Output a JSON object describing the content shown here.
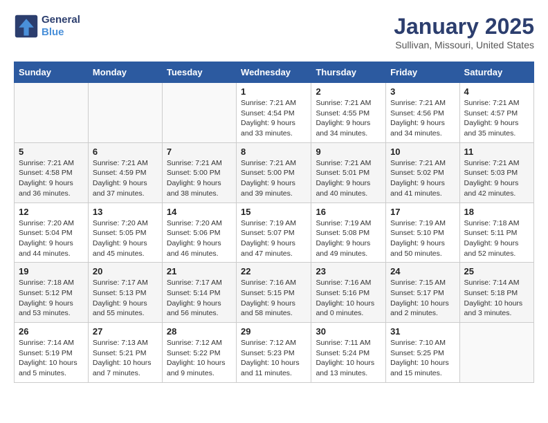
{
  "logo": {
    "line1": "General",
    "line2": "Blue"
  },
  "title": "January 2025",
  "subtitle": "Sullivan, Missouri, United States",
  "days_of_week": [
    "Sunday",
    "Monday",
    "Tuesday",
    "Wednesday",
    "Thursday",
    "Friday",
    "Saturday"
  ],
  "weeks": [
    [
      {
        "day": "",
        "text": ""
      },
      {
        "day": "",
        "text": ""
      },
      {
        "day": "",
        "text": ""
      },
      {
        "day": "1",
        "text": "Sunrise: 7:21 AM\nSunset: 4:54 PM\nDaylight: 9 hours and 33 minutes."
      },
      {
        "day": "2",
        "text": "Sunrise: 7:21 AM\nSunset: 4:55 PM\nDaylight: 9 hours and 34 minutes."
      },
      {
        "day": "3",
        "text": "Sunrise: 7:21 AM\nSunset: 4:56 PM\nDaylight: 9 hours and 34 minutes."
      },
      {
        "day": "4",
        "text": "Sunrise: 7:21 AM\nSunset: 4:57 PM\nDaylight: 9 hours and 35 minutes."
      }
    ],
    [
      {
        "day": "5",
        "text": "Sunrise: 7:21 AM\nSunset: 4:58 PM\nDaylight: 9 hours and 36 minutes."
      },
      {
        "day": "6",
        "text": "Sunrise: 7:21 AM\nSunset: 4:59 PM\nDaylight: 9 hours and 37 minutes."
      },
      {
        "day": "7",
        "text": "Sunrise: 7:21 AM\nSunset: 5:00 PM\nDaylight: 9 hours and 38 minutes."
      },
      {
        "day": "8",
        "text": "Sunrise: 7:21 AM\nSunset: 5:00 PM\nDaylight: 9 hours and 39 minutes."
      },
      {
        "day": "9",
        "text": "Sunrise: 7:21 AM\nSunset: 5:01 PM\nDaylight: 9 hours and 40 minutes."
      },
      {
        "day": "10",
        "text": "Sunrise: 7:21 AM\nSunset: 5:02 PM\nDaylight: 9 hours and 41 minutes."
      },
      {
        "day": "11",
        "text": "Sunrise: 7:21 AM\nSunset: 5:03 PM\nDaylight: 9 hours and 42 minutes."
      }
    ],
    [
      {
        "day": "12",
        "text": "Sunrise: 7:20 AM\nSunset: 5:04 PM\nDaylight: 9 hours and 44 minutes."
      },
      {
        "day": "13",
        "text": "Sunrise: 7:20 AM\nSunset: 5:05 PM\nDaylight: 9 hours and 45 minutes."
      },
      {
        "day": "14",
        "text": "Sunrise: 7:20 AM\nSunset: 5:06 PM\nDaylight: 9 hours and 46 minutes."
      },
      {
        "day": "15",
        "text": "Sunrise: 7:19 AM\nSunset: 5:07 PM\nDaylight: 9 hours and 47 minutes."
      },
      {
        "day": "16",
        "text": "Sunrise: 7:19 AM\nSunset: 5:08 PM\nDaylight: 9 hours and 49 minutes."
      },
      {
        "day": "17",
        "text": "Sunrise: 7:19 AM\nSunset: 5:10 PM\nDaylight: 9 hours and 50 minutes."
      },
      {
        "day": "18",
        "text": "Sunrise: 7:18 AM\nSunset: 5:11 PM\nDaylight: 9 hours and 52 minutes."
      }
    ],
    [
      {
        "day": "19",
        "text": "Sunrise: 7:18 AM\nSunset: 5:12 PM\nDaylight: 9 hours and 53 minutes."
      },
      {
        "day": "20",
        "text": "Sunrise: 7:17 AM\nSunset: 5:13 PM\nDaylight: 9 hours and 55 minutes."
      },
      {
        "day": "21",
        "text": "Sunrise: 7:17 AM\nSunset: 5:14 PM\nDaylight: 9 hours and 56 minutes."
      },
      {
        "day": "22",
        "text": "Sunrise: 7:16 AM\nSunset: 5:15 PM\nDaylight: 9 hours and 58 minutes."
      },
      {
        "day": "23",
        "text": "Sunrise: 7:16 AM\nSunset: 5:16 PM\nDaylight: 10 hours and 0 minutes."
      },
      {
        "day": "24",
        "text": "Sunrise: 7:15 AM\nSunset: 5:17 PM\nDaylight: 10 hours and 2 minutes."
      },
      {
        "day": "25",
        "text": "Sunrise: 7:14 AM\nSunset: 5:18 PM\nDaylight: 10 hours and 3 minutes."
      }
    ],
    [
      {
        "day": "26",
        "text": "Sunrise: 7:14 AM\nSunset: 5:19 PM\nDaylight: 10 hours and 5 minutes."
      },
      {
        "day": "27",
        "text": "Sunrise: 7:13 AM\nSunset: 5:21 PM\nDaylight: 10 hours and 7 minutes."
      },
      {
        "day": "28",
        "text": "Sunrise: 7:12 AM\nSunset: 5:22 PM\nDaylight: 10 hours and 9 minutes."
      },
      {
        "day": "29",
        "text": "Sunrise: 7:12 AM\nSunset: 5:23 PM\nDaylight: 10 hours and 11 minutes."
      },
      {
        "day": "30",
        "text": "Sunrise: 7:11 AM\nSunset: 5:24 PM\nDaylight: 10 hours and 13 minutes."
      },
      {
        "day": "31",
        "text": "Sunrise: 7:10 AM\nSunset: 5:25 PM\nDaylight: 10 hours and 15 minutes."
      },
      {
        "day": "",
        "text": ""
      }
    ]
  ]
}
